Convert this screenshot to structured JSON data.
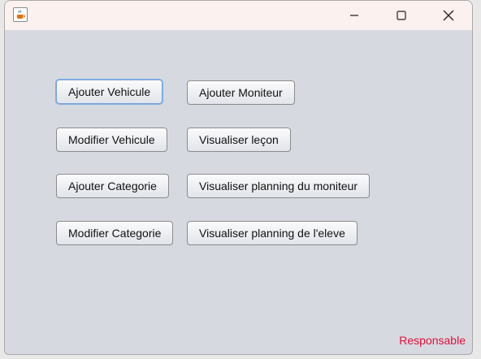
{
  "window": {
    "controls": {
      "minimize_icon": "minimize-icon",
      "maximize_icon": "maximize-icon",
      "close_icon": "close-icon"
    },
    "app_icon": "java-coffee-icon"
  },
  "buttons": {
    "ajouter_vehicule": "Ajouter Vehicule",
    "ajouter_moniteur": "Ajouter Moniteur",
    "modifier_vehicule": "Modifier Vehicule",
    "visualiser_lecon": "Visualiser leçon",
    "ajouter_categorie": "Ajouter Categorie",
    "visualiser_planning_moniteur": "Visualiser planning du moniteur",
    "modifier_categorie": "Modifier Categorie",
    "visualiser_planning_eleve": "Visualiser planning de l'eleve"
  },
  "footer": {
    "role_label": "Responsable"
  },
  "colors": {
    "role_label": "#e0103c",
    "panel_bg": "#d6d9e0",
    "titlebar_bg": "#fbf1ee"
  }
}
